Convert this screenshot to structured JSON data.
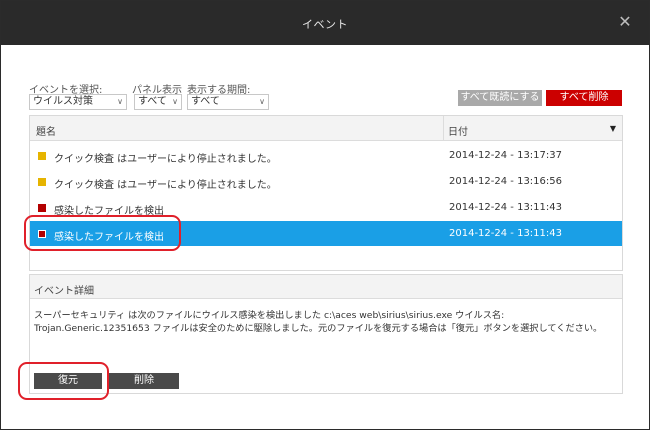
{
  "window": {
    "title": "イベント",
    "close_glyph": "✕"
  },
  "filters": [
    {
      "label": "イベントを選択:",
      "value": "ウイルス対策"
    },
    {
      "label": "パネル表示",
      "value": "すべて"
    },
    {
      "label": "表示する期間:",
      "value": "すべて"
    }
  ],
  "toolbar": {
    "mark_all_read": "すべて既読にする",
    "delete_all": "すべて削除"
  },
  "table": {
    "columns": [
      "題名",
      "日付"
    ],
    "rows": [
      {
        "title": "クイック検査 はユーザーにより停止されました。",
        "date": "2014-12-24 - 13:17:37",
        "color": "#e6b400"
      },
      {
        "title": "クイック検査 はユーザーにより停止されました。",
        "date": "2014-12-24 - 13:16:56",
        "color": "#e6b400"
      },
      {
        "title": "感染したファイルを検出",
        "date": "2014-12-24 - 13:11:43",
        "color": "#b30000"
      },
      {
        "title": "感染したファイルを検出",
        "date": "2014-12-24 - 13:11:43",
        "color": "#b30000",
        "selected": true
      }
    ]
  },
  "details": {
    "heading": "イベント詳細",
    "text": "スーパーセキュリティ は次のファイルにウイルス感染を検出しました c:\\aces web\\sirius\\sirius.exe ウイルス名: Trojan.Generic.12351653 ファイルは安全のために駆除しました。元のファイルを復元する場合は「復元」ボタンを選択してください。"
  },
  "actions": {
    "restore": "復元",
    "delete": "削除"
  },
  "colors": {
    "accent": "#cc0000",
    "selection": "#1a9fe6",
    "titlebar": "#2a2a2a",
    "highlight": "#e0202a"
  }
}
